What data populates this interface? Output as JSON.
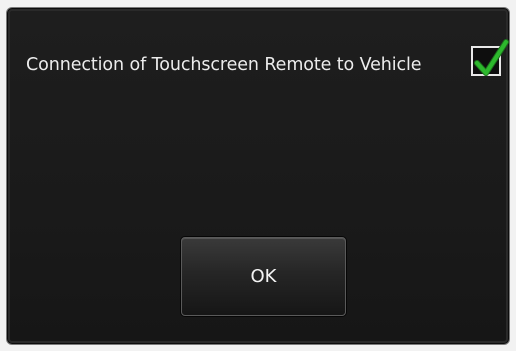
{
  "dialog": {
    "message": "Connection of Touchscreen Remote to Vehicle",
    "checkbox": {
      "checked": true,
      "icon": "checkmark-icon",
      "check_color": "#2db82d"
    },
    "ok_label": "OK"
  }
}
